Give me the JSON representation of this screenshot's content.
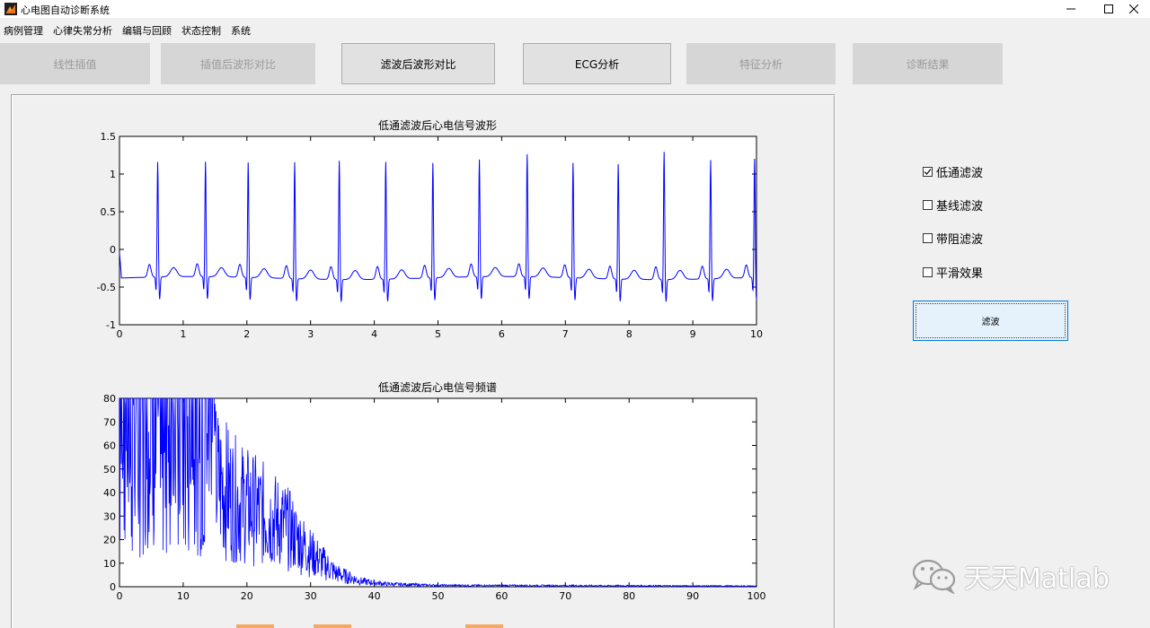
{
  "window": {
    "title": "心电图自动诊断系统",
    "controls": [
      "minimize-icon",
      "maximize-icon",
      "close-icon"
    ]
  },
  "menu": [
    "病例管理",
    "心律失常分析",
    "编辑与回顾",
    "状态控制",
    "系统"
  ],
  "toolbar": [
    {
      "label": "线性插值",
      "enabled": false
    },
    {
      "label": "插值后波形对比",
      "enabled": false
    },
    {
      "label": "滤波后波形对比",
      "enabled": true
    },
    {
      "label": "ECG分析",
      "enabled": true
    },
    {
      "label": "特征分析",
      "enabled": false
    },
    {
      "label": "诊断结果",
      "enabled": false
    }
  ],
  "plots": {
    "waveform_title": "低通滤波后心电信号波形",
    "spectrum_title": "低通滤波后心电信号频谱"
  },
  "chart_data": [
    {
      "type": "line",
      "title": "低通滤波后心电信号波形",
      "xlim": [
        0,
        10
      ],
      "ylim": [
        -1,
        1.5
      ],
      "xticks": [
        0,
        1,
        2,
        3,
        4,
        5,
        6,
        7,
        8,
        9,
        10
      ],
      "yticks": [
        -1,
        -0.5,
        0,
        0.5,
        1,
        1.5
      ],
      "ytick_labels": [
        "-1",
        "-0.5",
        "0",
        "0.5",
        "1",
        "1.5"
      ],
      "color": "#0000ff",
      "baseline": -0.38,
      "r_peaks": [
        {
          "t": 0.6,
          "amp": 1.15
        },
        {
          "t": 1.35,
          "amp": 1.15
        },
        {
          "t": 2.02,
          "amp": 1.15
        },
        {
          "t": 2.75,
          "amp": 1.17
        },
        {
          "t": 3.45,
          "amp": 1.2
        },
        {
          "t": 4.18,
          "amp": 1.18
        },
        {
          "t": 4.92,
          "amp": 1.15
        },
        {
          "t": 5.65,
          "amp": 1.18
        },
        {
          "t": 6.4,
          "amp": 1.25
        },
        {
          "t": 7.12,
          "amp": 1.15
        },
        {
          "t": 7.83,
          "amp": 1.15
        },
        {
          "t": 8.55,
          "amp": 1.32
        },
        {
          "t": 9.28,
          "amp": 1.2
        },
        {
          "t": 9.97,
          "amp": 1.2
        }
      ]
    },
    {
      "type": "line",
      "title": "低通滤波后心电信号频谱",
      "xlim": [
        0,
        100
      ],
      "ylim": [
        0,
        80
      ],
      "xticks": [
        0,
        10,
        20,
        30,
        40,
        50,
        60,
        70,
        80,
        90,
        100
      ],
      "yticks": [
        0,
        10,
        20,
        30,
        40,
        50,
        60,
        70,
        80
      ],
      "color": "#0000ff",
      "envelope": [
        [
          0,
          80
        ],
        [
          15,
          80
        ],
        [
          18,
          65
        ],
        [
          22,
          55
        ],
        [
          26,
          45
        ],
        [
          30,
          25
        ],
        [
          34,
          10
        ],
        [
          38,
          4
        ],
        [
          42,
          2
        ],
        [
          50,
          1
        ],
        [
          100,
          0.5
        ]
      ]
    }
  ],
  "options": [
    {
      "label": "低通滤波",
      "checked": true
    },
    {
      "label": "基线滤波",
      "checked": false
    },
    {
      "label": "带阻滤波",
      "checked": false
    },
    {
      "label": "平滑效果",
      "checked": false
    }
  ],
  "filter_button": "滤波",
  "watermark": "天天Matlab"
}
